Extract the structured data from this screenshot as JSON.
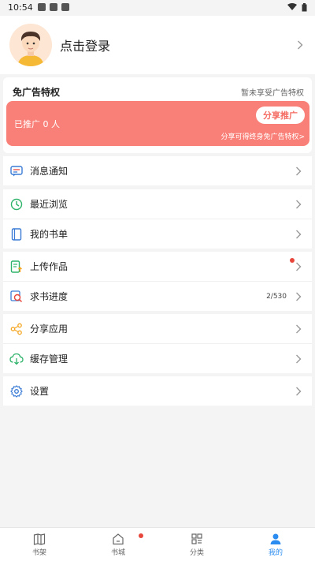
{
  "status": {
    "time": "10:54"
  },
  "profile": {
    "login_text": "点击登录"
  },
  "ad": {
    "title": "免广告特权",
    "status": "暂未享受广告特权",
    "promoted": "已推广 0 人",
    "share_button": "分享推广",
    "share_note": "分享可得终身免广告特权>"
  },
  "menu": {
    "notifications": "消息通知",
    "recent": "最近浏览",
    "booklist": "我的书单",
    "upload": "上传作品",
    "request": "求书进度",
    "request_progress": "2/530",
    "share_app": "分享应用",
    "cache": "缓存管理",
    "settings": "设置"
  },
  "nav": {
    "bookshelf": "书架",
    "store": "书城",
    "category": "分类",
    "mine": "我的"
  },
  "colors": {
    "accent": "#2a8cf0",
    "banner": "#f98078",
    "badge": "#e8463b"
  }
}
